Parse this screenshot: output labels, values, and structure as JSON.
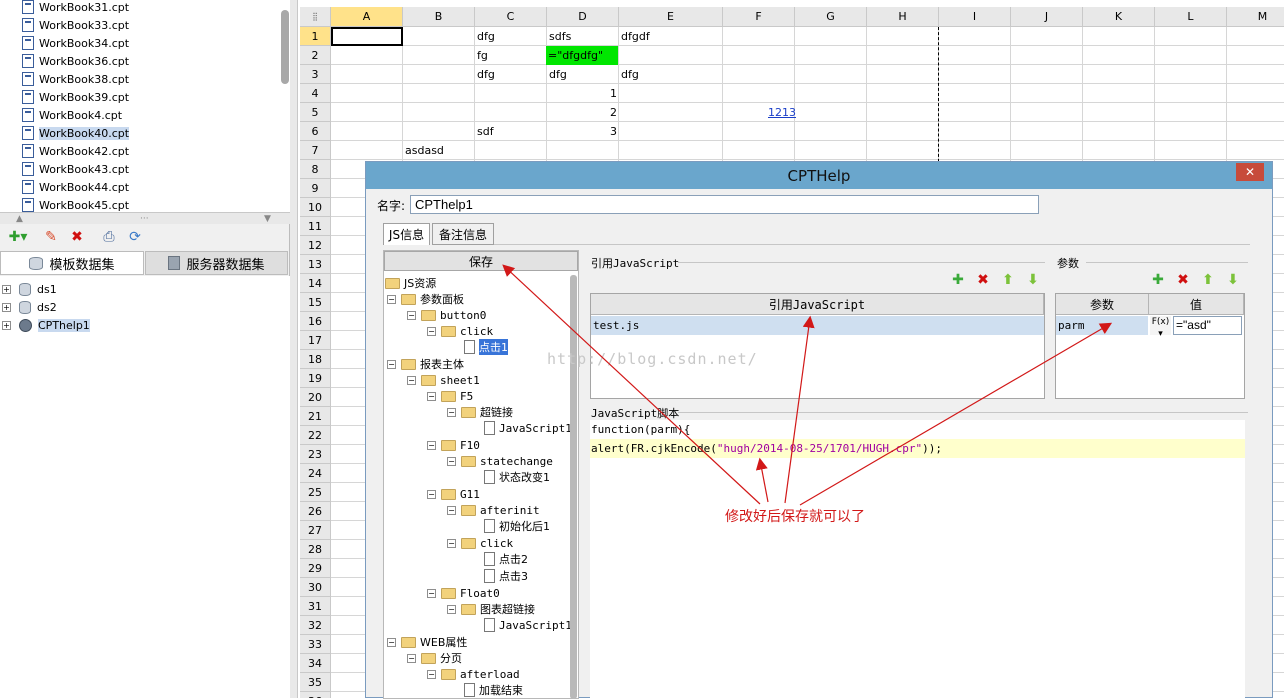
{
  "files": {
    "items": [
      "WorkBook31.cpt",
      "WorkBook33.cpt",
      "WorkBook34.cpt",
      "WorkBook36.cpt",
      "WorkBook38.cpt",
      "WorkBook39.cpt",
      "WorkBook4.cpt",
      "WorkBook40.cpt",
      "WorkBook42.cpt",
      "WorkBook43.cpt",
      "WorkBook44.cpt",
      "WorkBook45.cpt"
    ],
    "selected": "WorkBook40.cpt"
  },
  "datasource_tabs": {
    "template": "模板数据集",
    "server": "服务器数据集"
  },
  "datasets": [
    "ds1",
    "ds2",
    "CPThelp1"
  ],
  "sheet": {
    "columns": [
      "A",
      "B",
      "C",
      "D",
      "E",
      "F",
      "G",
      "H",
      "I",
      "J",
      "K",
      "L",
      "M"
    ],
    "rows": [
      "1",
      "2",
      "3",
      "4",
      "5",
      "6",
      "7",
      "8",
      "9",
      "10",
      "11",
      "12",
      "13",
      "14",
      "15",
      "16",
      "17",
      "18",
      "19",
      "20",
      "21",
      "22",
      "23",
      "24",
      "25",
      "26",
      "27",
      "28",
      "29",
      "30",
      "31",
      "32",
      "33",
      "34",
      "35",
      "36"
    ],
    "cells": {
      "c1": "dfg",
      "d1": "sdfs",
      "e1": "dfgdf",
      "c2": "fg",
      "d2": "=\"dfgdfg\"",
      "c3": "dfg",
      "d3": "dfg",
      "e3": "dfg",
      "d4": "1",
      "d5": "2",
      "f5": "1213",
      "c6": "sdf",
      "d6": "3",
      "b7": "asdasd"
    }
  },
  "dialog": {
    "title": "CPTHelp",
    "name_label": "名字:",
    "name_value": "CPThelp1",
    "tabs": [
      "JS信息",
      "备注信息"
    ],
    "save_label": "保存",
    "tree": {
      "root": "JS资源",
      "param_panel": "参数面板",
      "button0": "button0",
      "click": "click",
      "dianji1": "点击1",
      "report_body": "报表主体",
      "sheet1": "sheet1",
      "f5": "F5",
      "hyperlink": "超链接",
      "javascript1": "JavaScript1",
      "f10": "F10",
      "statechange": "statechange",
      "state1": "状态改变1",
      "g11": "G11",
      "afterinit": "afterinit",
      "init1": "初始化后1",
      "click2": "click",
      "dianji2": "点击2",
      "dianji3": "点击3",
      "float0": "Float0",
      "chart_link": "图表超链接",
      "javascript1b": "JavaScript1",
      "web_attr": "WEB属性",
      "paging": "分页",
      "afterload": "afterload",
      "load_done": "加载结束"
    },
    "ref_js_section": "引用JavaScript",
    "ref_js_header": "引用JavaScript",
    "ref_js_row": "test.js",
    "params_section": "参数",
    "params_header_name": "参数",
    "params_header_value": "值",
    "param_name": "parm",
    "param_fx": "F(x)",
    "param_value": "=\"asd\"",
    "script_section": "JavaScript脚本",
    "script_line1": "function(parm){",
    "script_line2_prefix": "alert(FR.cjkEncode(",
    "script_line2_string": "\"hugh/2014-08-25/1701/HUGH.cpr\"",
    "script_line2_suffix": "));"
  },
  "watermark": "http://blog.csdn.net/",
  "annotation": "修改好后保存就可以了",
  "colors": {
    "accent_title": "#6aa6cc",
    "green_cell": "#00e600",
    "annotation": "#d21818",
    "active_header": "#ffe28a"
  }
}
